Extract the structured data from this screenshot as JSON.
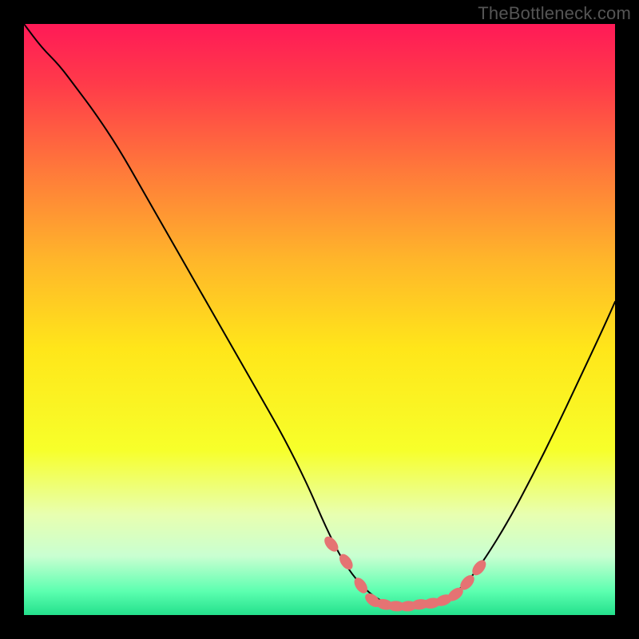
{
  "watermark": "TheBottleneck.com",
  "chart_data": {
    "type": "line",
    "title": "",
    "xlabel": "",
    "ylabel": "",
    "xlim": [
      0,
      100
    ],
    "ylim": [
      0,
      100
    ],
    "background_gradient": {
      "stops": [
        {
          "offset": 0.0,
          "color": "#ff1a57"
        },
        {
          "offset": 0.1,
          "color": "#ff3a4a"
        },
        {
          "offset": 0.25,
          "color": "#ff7a3a"
        },
        {
          "offset": 0.4,
          "color": "#ffb62a"
        },
        {
          "offset": 0.55,
          "color": "#ffe61a"
        },
        {
          "offset": 0.72,
          "color": "#f7ff2a"
        },
        {
          "offset": 0.83,
          "color": "#e8ffb0"
        },
        {
          "offset": 0.9,
          "color": "#c9ffd1"
        },
        {
          "offset": 0.96,
          "color": "#5cffb0"
        },
        {
          "offset": 1.0,
          "color": "#24e08c"
        }
      ]
    },
    "series": [
      {
        "name": "curve",
        "type": "line",
        "color": "#000000",
        "x": [
          0.0,
          3.0,
          6.0,
          9.0,
          12.0,
          16.0,
          20.0,
          24.0,
          28.0,
          32.0,
          36.0,
          40.0,
          44.0,
          48.0,
          51.0,
          54.0,
          57.0,
          60.0,
          63.0,
          66.0,
          69.0,
          72.0,
          75.0,
          78.0,
          82.0,
          86.0,
          90.0,
          94.0,
          98.0,
          100.0
        ],
        "y": [
          100.0,
          96.0,
          93.0,
          89.0,
          85.0,
          79.0,
          72.0,
          65.0,
          58.0,
          51.0,
          44.0,
          37.0,
          30.0,
          22.0,
          15.0,
          9.0,
          5.0,
          2.5,
          1.5,
          1.5,
          2.0,
          3.0,
          5.5,
          9.5,
          16.0,
          23.5,
          31.5,
          40.0,
          48.5,
          53.0
        ]
      },
      {
        "name": "markers",
        "type": "scatter",
        "color": "#e57373",
        "x": [
          52.0,
          54.5,
          57.0,
          59.0,
          61.0,
          63.0,
          65.0,
          67.0,
          69.0,
          71.0,
          73.0,
          75.0,
          77.0
        ],
        "y": [
          12.0,
          9.0,
          5.0,
          2.5,
          1.8,
          1.5,
          1.5,
          1.8,
          2.0,
          2.5,
          3.5,
          5.5,
          8.0
        ]
      }
    ]
  }
}
